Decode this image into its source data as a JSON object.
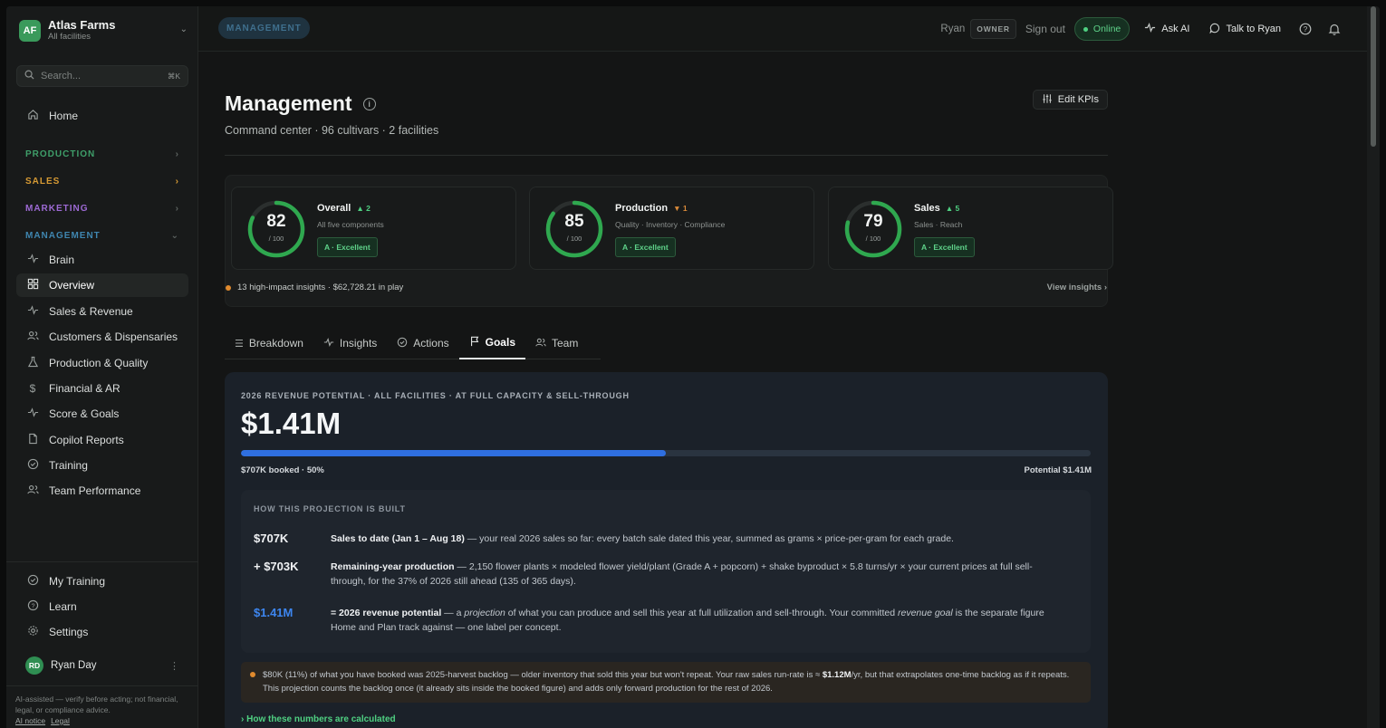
{
  "brand": {
    "initials": "AF",
    "name": "Atlas Farms",
    "sub": "All facilities"
  },
  "search": {
    "placeholder": "Search...",
    "shortcut": "⌘K"
  },
  "sidebar": {
    "home": "Home",
    "sections": [
      {
        "label": "PRODUCTION",
        "color": "#3f9f6a"
      },
      {
        "label": "SALES",
        "color": "#d69a34"
      },
      {
        "label": "MARKETING",
        "color": "#9d6ad4"
      },
      {
        "label": "MANAGEMENT",
        "color": "#3f86b0"
      }
    ],
    "items": [
      "Brain",
      "Overview",
      "Sales & Revenue",
      "Customers & Dispensaries",
      "Production & Quality",
      "Financial & AR",
      "Score & Goals",
      "Copilot Reports",
      "Training",
      "Team Performance"
    ],
    "bottom_items": [
      "My Training",
      "Learn",
      "Settings"
    ],
    "user": {
      "initials": "RD",
      "name": "Ryan Day"
    },
    "disclaimer": "AI-assisted — verify before acting; not financial, legal, or compliance advice.",
    "links": [
      "AI notice",
      "Legal"
    ]
  },
  "topbar": {
    "crumb": "MANAGEMENT",
    "user": "Ryan",
    "role": "OWNER",
    "sign_out": "Sign out",
    "status": "Online",
    "ask_ai": "Ask AI",
    "talk": "Talk to Ryan"
  },
  "page": {
    "title": "Management",
    "subtitle": "Command center · 96 cultivars · 2 facilities",
    "edit_kpis": "Edit KPIs"
  },
  "kpis": [
    {
      "title": "Overall",
      "delta": "▲ 2",
      "dir": "up",
      "sub": "All five components",
      "score": "82",
      "den": "/ 100",
      "grade": "A · Excellent"
    },
    {
      "title": "Production",
      "delta": "▼ 1",
      "dir": "down",
      "sub": "Quality · Inventory · Compliance",
      "score": "85",
      "den": "/ 100",
      "grade": "A · Excellent"
    },
    {
      "title": "Sales",
      "delta": "▲ 5",
      "dir": "up",
      "sub": "Sales · Reach",
      "score": "79",
      "den": "/ 100",
      "grade": "A · Excellent"
    }
  ],
  "insights": {
    "line": "13 high-impact insights · $62,728.21 in play",
    "link": "View insights ›"
  },
  "tabs": [
    "Breakdown",
    "Insights",
    "Actions",
    "Goals",
    "Team"
  ],
  "revenue": {
    "eyebrow": "2026 REVENUE POTENTIAL · ALL FACILITIES · AT FULL CAPACITY & SELL-THROUGH",
    "big": "$1.41M",
    "booked_fraction": 0.5,
    "left": "$707K booked · 50%",
    "right": "Potential $1.41M",
    "proj_header": "HOW THIS PROJECTION IS BUILT",
    "rows": [
      {
        "amt": "$707K",
        "lead": "Sales to date (Jan 1 – Aug 18)",
        "rest": " — your real 2026 sales so far: every batch sale dated this year, summed as grams × price-per-gram for each grade."
      },
      {
        "amt": "+ $703K",
        "lead": "Remaining-year production",
        "rest": " — 2,150 flower plants × modeled flower yield/plant (Grade A + popcorn) + shake byproduct × 5.8 turns/yr × your current prices at full sell-through, for the 37% of 2026 still ahead (135 of 365 days)."
      },
      {
        "amt": "$1.41M",
        "lead": "= 2026 revenue potential",
        "rest_a": " — a ",
        "em1": "projection",
        "rest_b": " of what you can produce and sell this year at full utilization and sell-through. Your committed ",
        "em2": "revenue goal",
        "rest_c": " is the separate figure Home and Plan track against — one label per concept."
      }
    ],
    "note_a": "$80K (11%) of what you have booked was 2025-harvest backlog — older inventory that sold this year but won't repeat. Your raw sales run-rate is ≈ ",
    "note_bold": "$1.12M",
    "note_b": "/yr, but that extrapolates one-time backlog as if it repeats. This projection counts the backlog once (it already sits inside the booked figure) and adds only forward production for the rest of 2026.",
    "calc_link": "› How these numbers are calculated"
  }
}
